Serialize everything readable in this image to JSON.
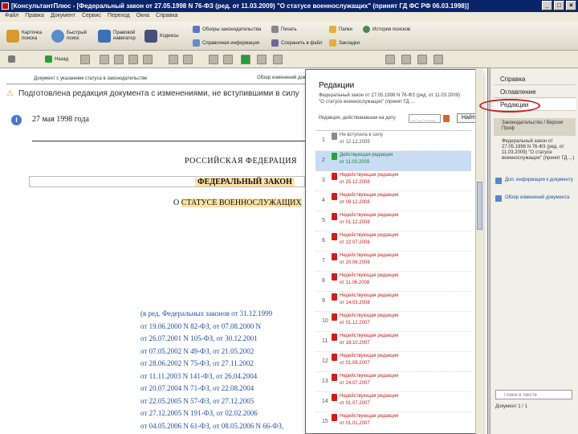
{
  "window": {
    "title": "[КонсультантПлюс - [Федеральный закон от 27.05.1998 N 76-ФЗ (ред. от 11.03.2009) \"О статусе военнослужащих\" (принят ГД ФС РФ 06.03.1998)]"
  },
  "menu": [
    "Файл",
    "Правка",
    "Документ",
    "Сервис",
    "Переход",
    "Окна",
    "Справка"
  ],
  "toolbar": {
    "btn_card": "Карточка поиска",
    "btn_fast": "Быстрый поиск",
    "btn_guide": "Правовой навигатор",
    "btn_codes": "Кодексы",
    "btn_review": "Обзоры законодательства",
    "btn_ref": "Справочная информация",
    "btn_folders": "Папки",
    "btn_history": "История поисков",
    "btn_bookmarks": "Закладки",
    "btn_print": "Печать",
    "btn_save": "Сохранить в файл",
    "btn_back": "Назад"
  },
  "document": {
    "header_link": "Документ с указанием статуса в законодательстве",
    "header_label": "Обзор изменений документа",
    "warning": "Подготовлена редакция документа с изменениями, не вступившими в силу",
    "date": "27 мая 1998 года",
    "country": "РОССИЙСКАЯ ФЕДЕРАЦИЯ",
    "law": "ФЕДЕРАЛЬНЫЙ ЗАКОН",
    "subject_prefix": "О",
    "subject_highlight": "СТАТУСЕ ВОЕННОСЛУЖАЩИХ",
    "editions": [
      "(в ред. Федеральных законов от 31.12.1999",
      "от 19.06.2000 N 82-ФЗ, от 07.08.2000 N",
      "от 26.07.2001 N 105-ФЗ, от 30.12.2001",
      "от 07.05.2002 N 49-ФЗ, от 21.05.2002",
      "от 28.06.2002 N 75-ФЗ, от 27.11.2002",
      "от 11.11.2003 N 141-ФЗ, от 26.04.2004",
      "от 20.07.2004 N 71-ФЗ, от 22.08.2004",
      "от 22.05.2005 N 57-ФЗ, от 27.12.2005",
      "от 27.12.2005 N 191-ФЗ, от 02.02.2006",
      "от 04.05.2006 N 61-ФЗ, от 08.05.2006 N 66-ФЗ,"
    ]
  },
  "panel": {
    "title": "Редакции",
    "description": "Федеральный закон от 27.05.1998 N 76-ФЗ (ред. от 11.03.2009) \"О статусе военнослужащих\" (принят ГД ...",
    "date_label": "Редакция, действовавшая на дату",
    "date_placeholder": "__.__.____",
    "go_label": "Найти",
    "editions": [
      {
        "num": "1",
        "status": "Не вступила в силу",
        "date": "от 12.12.2009",
        "state": "gray"
      },
      {
        "num": "2",
        "status": "Действующая редакция",
        "date": "от 11.03.2009",
        "state": "green"
      },
      {
        "num": "3",
        "status": "Недействующая редакция",
        "date": "от 25.12.2008",
        "state": "red"
      },
      {
        "num": "4",
        "status": "Недействующая редакция",
        "date": "от 09.12.2008",
        "state": "red"
      },
      {
        "num": "5",
        "status": "Недействующая редакция",
        "date": "от 01.12.2008",
        "state": "red"
      },
      {
        "num": "6",
        "status": "Недействующая редакция",
        "date": "от 22.07.2008",
        "state": "red"
      },
      {
        "num": "7",
        "status": "Недействующая редакция",
        "date": "от 20.06.2008",
        "state": "red"
      },
      {
        "num": "8",
        "status": "Недействующая редакция",
        "date": "от 11.06.2008",
        "state": "red"
      },
      {
        "num": "9",
        "status": "Недействующая редакция",
        "date": "от 14.03.2008",
        "state": "red"
      },
      {
        "num": "10",
        "status": "Недействующая редакция",
        "date": "от 01.12.2007",
        "state": "red"
      },
      {
        "num": "11",
        "status": "Недействующая редакция",
        "date": "от 18.10.2007",
        "state": "red"
      },
      {
        "num": "12",
        "status": "Недействующая редакция",
        "date": "от 01.09.2007",
        "state": "red"
      },
      {
        "num": "13",
        "status": "Недействующая редакция",
        "date": "от 24.07.2007",
        "state": "red"
      },
      {
        "num": "14",
        "status": "Недействующая редакция",
        "date": "от 01.07.2007",
        "state": "red"
      },
      {
        "num": "15",
        "status": "Недействующая редакция",
        "date": "от 01.01.2007",
        "state": "red"
      }
    ]
  },
  "sidebar": {
    "tabs": [
      "Справка",
      "Оглавление",
      "Редакции"
    ],
    "legislation_block": "Законодательство / Версия Проф",
    "doc_info": "Федеральный закон от 27.05.1998 N 76-ФЗ (ред. от 11.03.2009) \"О статусе военнослужащих\" (принят ГД ...)",
    "link1": "Доп. информация к документу",
    "link2": "Обзор изменений документа",
    "search_placeholder": "Поиск в тексте",
    "footer": "Документ 1 / 1"
  }
}
